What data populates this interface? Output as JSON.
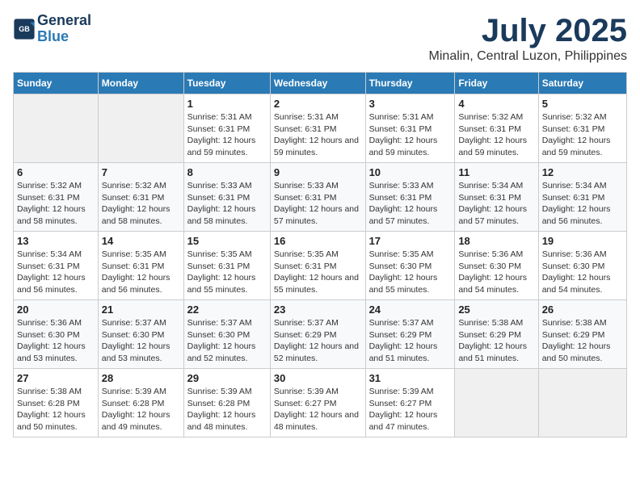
{
  "header": {
    "logo_line1": "General",
    "logo_line2": "Blue",
    "month": "July 2025",
    "location": "Minalin, Central Luzon, Philippines"
  },
  "days_of_week": [
    "Sunday",
    "Monday",
    "Tuesday",
    "Wednesday",
    "Thursday",
    "Friday",
    "Saturday"
  ],
  "weeks": [
    [
      {
        "day": "",
        "sunrise": "",
        "sunset": "",
        "daylight": ""
      },
      {
        "day": "",
        "sunrise": "",
        "sunset": "",
        "daylight": ""
      },
      {
        "day": "1",
        "sunrise": "Sunrise: 5:31 AM",
        "sunset": "Sunset: 6:31 PM",
        "daylight": "Daylight: 12 hours and 59 minutes."
      },
      {
        "day": "2",
        "sunrise": "Sunrise: 5:31 AM",
        "sunset": "Sunset: 6:31 PM",
        "daylight": "Daylight: 12 hours and 59 minutes."
      },
      {
        "day": "3",
        "sunrise": "Sunrise: 5:31 AM",
        "sunset": "Sunset: 6:31 PM",
        "daylight": "Daylight: 12 hours and 59 minutes."
      },
      {
        "day": "4",
        "sunrise": "Sunrise: 5:32 AM",
        "sunset": "Sunset: 6:31 PM",
        "daylight": "Daylight: 12 hours and 59 minutes."
      },
      {
        "day": "5",
        "sunrise": "Sunrise: 5:32 AM",
        "sunset": "Sunset: 6:31 PM",
        "daylight": "Daylight: 12 hours and 59 minutes."
      }
    ],
    [
      {
        "day": "6",
        "sunrise": "Sunrise: 5:32 AM",
        "sunset": "Sunset: 6:31 PM",
        "daylight": "Daylight: 12 hours and 58 minutes."
      },
      {
        "day": "7",
        "sunrise": "Sunrise: 5:32 AM",
        "sunset": "Sunset: 6:31 PM",
        "daylight": "Daylight: 12 hours and 58 minutes."
      },
      {
        "day": "8",
        "sunrise": "Sunrise: 5:33 AM",
        "sunset": "Sunset: 6:31 PM",
        "daylight": "Daylight: 12 hours and 58 minutes."
      },
      {
        "day": "9",
        "sunrise": "Sunrise: 5:33 AM",
        "sunset": "Sunset: 6:31 PM",
        "daylight": "Daylight: 12 hours and 57 minutes."
      },
      {
        "day": "10",
        "sunrise": "Sunrise: 5:33 AM",
        "sunset": "Sunset: 6:31 PM",
        "daylight": "Daylight: 12 hours and 57 minutes."
      },
      {
        "day": "11",
        "sunrise": "Sunrise: 5:34 AM",
        "sunset": "Sunset: 6:31 PM",
        "daylight": "Daylight: 12 hours and 57 minutes."
      },
      {
        "day": "12",
        "sunrise": "Sunrise: 5:34 AM",
        "sunset": "Sunset: 6:31 PM",
        "daylight": "Daylight: 12 hours and 56 minutes."
      }
    ],
    [
      {
        "day": "13",
        "sunrise": "Sunrise: 5:34 AM",
        "sunset": "Sunset: 6:31 PM",
        "daylight": "Daylight: 12 hours and 56 minutes."
      },
      {
        "day": "14",
        "sunrise": "Sunrise: 5:35 AM",
        "sunset": "Sunset: 6:31 PM",
        "daylight": "Daylight: 12 hours and 56 minutes."
      },
      {
        "day": "15",
        "sunrise": "Sunrise: 5:35 AM",
        "sunset": "Sunset: 6:31 PM",
        "daylight": "Daylight: 12 hours and 55 minutes."
      },
      {
        "day": "16",
        "sunrise": "Sunrise: 5:35 AM",
        "sunset": "Sunset: 6:31 PM",
        "daylight": "Daylight: 12 hours and 55 minutes."
      },
      {
        "day": "17",
        "sunrise": "Sunrise: 5:35 AM",
        "sunset": "Sunset: 6:30 PM",
        "daylight": "Daylight: 12 hours and 55 minutes."
      },
      {
        "day": "18",
        "sunrise": "Sunrise: 5:36 AM",
        "sunset": "Sunset: 6:30 PM",
        "daylight": "Daylight: 12 hours and 54 minutes."
      },
      {
        "day": "19",
        "sunrise": "Sunrise: 5:36 AM",
        "sunset": "Sunset: 6:30 PM",
        "daylight": "Daylight: 12 hours and 54 minutes."
      }
    ],
    [
      {
        "day": "20",
        "sunrise": "Sunrise: 5:36 AM",
        "sunset": "Sunset: 6:30 PM",
        "daylight": "Daylight: 12 hours and 53 minutes."
      },
      {
        "day": "21",
        "sunrise": "Sunrise: 5:37 AM",
        "sunset": "Sunset: 6:30 PM",
        "daylight": "Daylight: 12 hours and 53 minutes."
      },
      {
        "day": "22",
        "sunrise": "Sunrise: 5:37 AM",
        "sunset": "Sunset: 6:30 PM",
        "daylight": "Daylight: 12 hours and 52 minutes."
      },
      {
        "day": "23",
        "sunrise": "Sunrise: 5:37 AM",
        "sunset": "Sunset: 6:29 PM",
        "daylight": "Daylight: 12 hours and 52 minutes."
      },
      {
        "day": "24",
        "sunrise": "Sunrise: 5:37 AM",
        "sunset": "Sunset: 6:29 PM",
        "daylight": "Daylight: 12 hours and 51 minutes."
      },
      {
        "day": "25",
        "sunrise": "Sunrise: 5:38 AM",
        "sunset": "Sunset: 6:29 PM",
        "daylight": "Daylight: 12 hours and 51 minutes."
      },
      {
        "day": "26",
        "sunrise": "Sunrise: 5:38 AM",
        "sunset": "Sunset: 6:29 PM",
        "daylight": "Daylight: 12 hours and 50 minutes."
      }
    ],
    [
      {
        "day": "27",
        "sunrise": "Sunrise: 5:38 AM",
        "sunset": "Sunset: 6:28 PM",
        "daylight": "Daylight: 12 hours and 50 minutes."
      },
      {
        "day": "28",
        "sunrise": "Sunrise: 5:39 AM",
        "sunset": "Sunset: 6:28 PM",
        "daylight": "Daylight: 12 hours and 49 minutes."
      },
      {
        "day": "29",
        "sunrise": "Sunrise: 5:39 AM",
        "sunset": "Sunset: 6:28 PM",
        "daylight": "Daylight: 12 hours and 48 minutes."
      },
      {
        "day": "30",
        "sunrise": "Sunrise: 5:39 AM",
        "sunset": "Sunset: 6:27 PM",
        "daylight": "Daylight: 12 hours and 48 minutes."
      },
      {
        "day": "31",
        "sunrise": "Sunrise: 5:39 AM",
        "sunset": "Sunset: 6:27 PM",
        "daylight": "Daylight: 12 hours and 47 minutes."
      },
      {
        "day": "",
        "sunrise": "",
        "sunset": "",
        "daylight": ""
      },
      {
        "day": "",
        "sunrise": "",
        "sunset": "",
        "daylight": ""
      }
    ]
  ]
}
